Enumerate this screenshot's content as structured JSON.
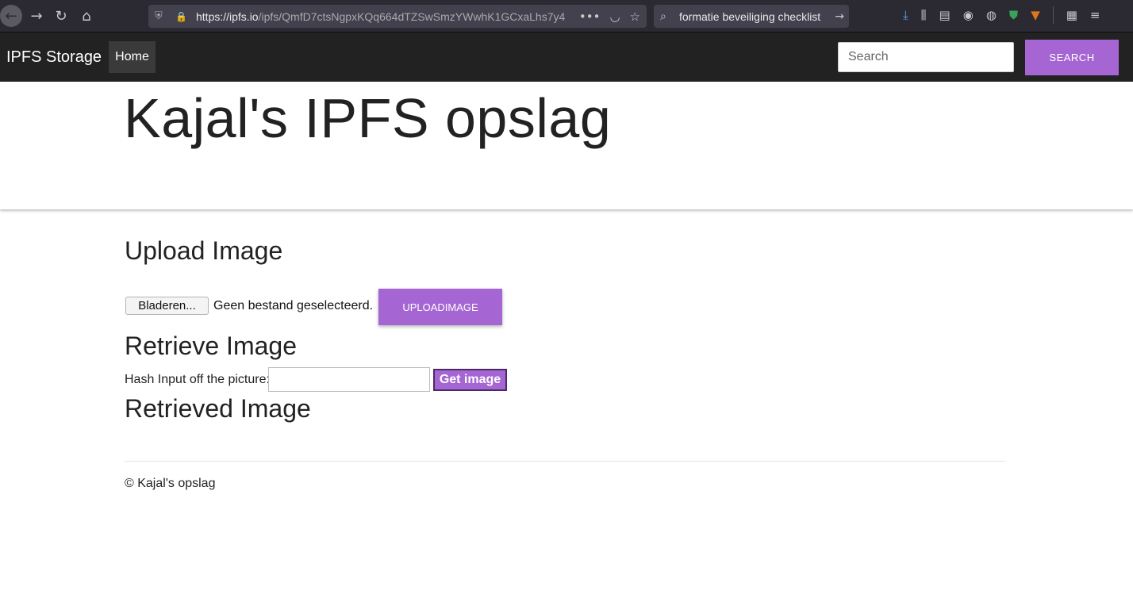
{
  "browser": {
    "url_host": "https://ipfs.io",
    "url_path": "/ipfs/QmfD7ctsNgpxKQq664dTZSwSmzYWwhK1GCxaLhs7y4",
    "search_query": "formatie beveiliging checklist"
  },
  "navbar": {
    "brand": "IPFS Storage",
    "home_label": "Home",
    "search_placeholder": "Search",
    "search_button": "SEARCH"
  },
  "jumbotron": {
    "title": "Kajal's IPFS opslag"
  },
  "upload": {
    "heading": "Upload Image",
    "file_button": "Bladeren...",
    "file_status": "Geen bestand geselecteerd.",
    "upload_button": "UPLOADIMAGE"
  },
  "retrieve": {
    "heading": "Retrieve Image",
    "hash_label": "Hash Input off the picture:",
    "hash_value": "",
    "get_button": "Get image"
  },
  "retrieved": {
    "heading": "Retrieved Image"
  },
  "footer": {
    "text": "© Kajal's opslag"
  },
  "colors": {
    "accent": "#a566d3",
    "navbar_bg": "#222222",
    "chrome_bg": "#2b2a33"
  }
}
